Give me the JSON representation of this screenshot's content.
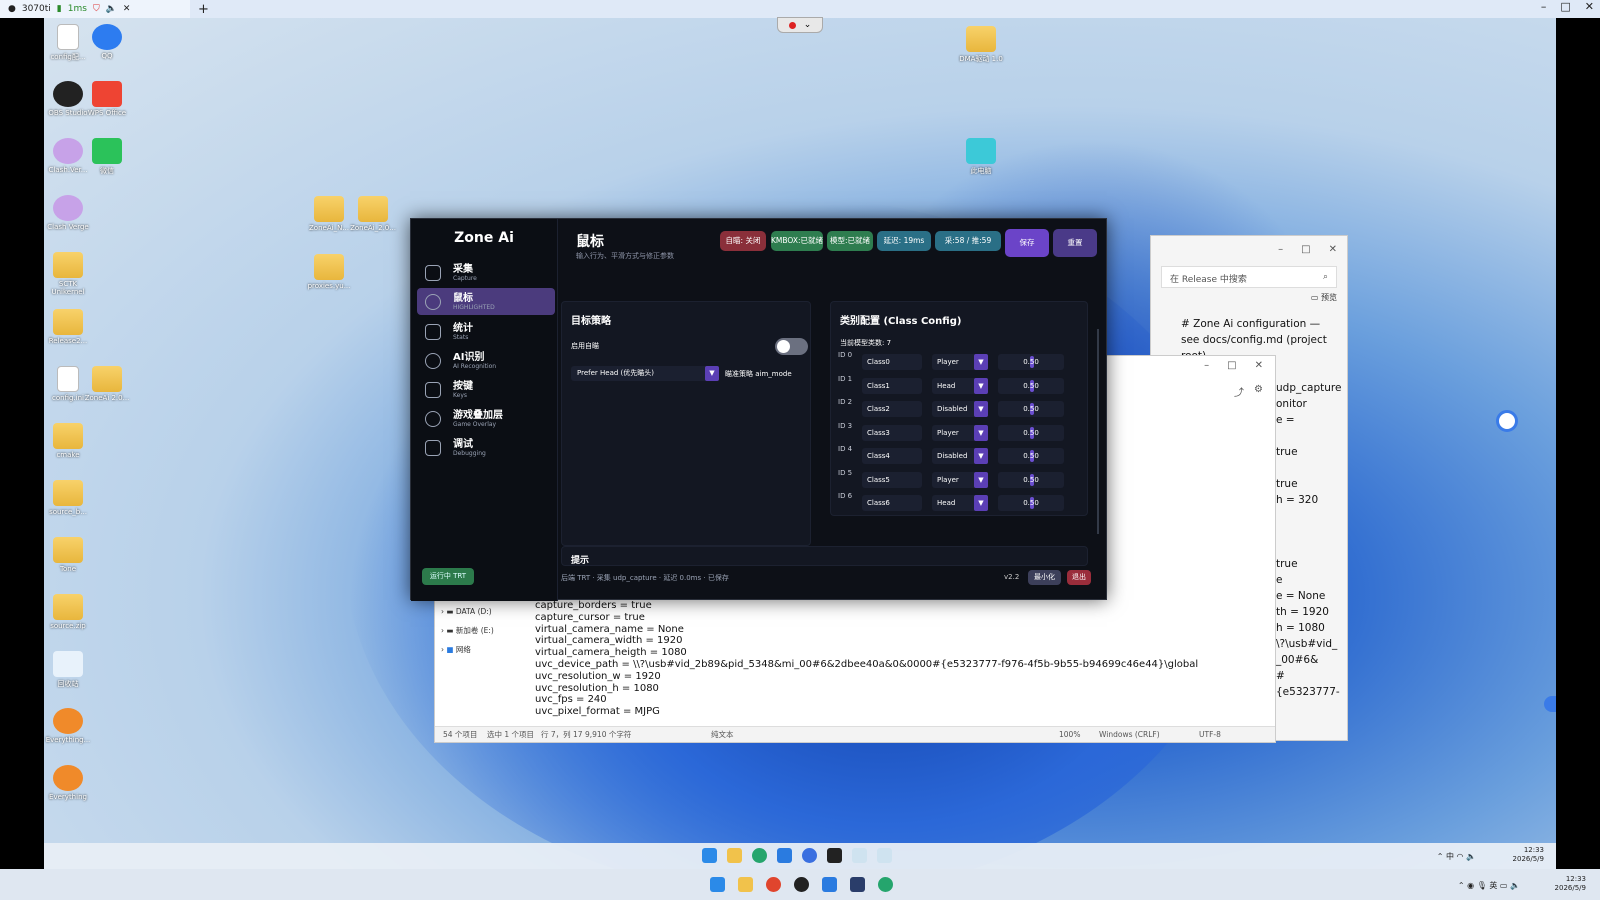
{
  "viewer": {
    "tab_title": "3070ti",
    "latency": "1ms"
  },
  "desktop_icons": [
    {
      "label": "config配...",
      "type": "doc"
    },
    {
      "label": "QQ",
      "type": "app"
    },
    {
      "label": "OBS Studio",
      "type": "app"
    },
    {
      "label": "WPS Office",
      "type": "app"
    },
    {
      "label": "Clash.Ver...",
      "type": "app"
    },
    {
      "label": "微信",
      "type": "app"
    },
    {
      "label": "Clash Verge",
      "type": "app"
    },
    {
      "label": "SCTK Unikernel",
      "type": "folder"
    },
    {
      "label": "Release2...",
      "type": "folder"
    },
    {
      "label": "config.ini",
      "type": "doc"
    },
    {
      "label": "ZoneAi 2.0...",
      "type": "folder"
    },
    {
      "label": "cmake",
      "type": "folder"
    },
    {
      "label": "source_b...",
      "type": "folder"
    },
    {
      "label": "Tone",
      "type": "folder"
    },
    {
      "label": "source.zip",
      "type": "folder"
    },
    {
      "label": "回收站",
      "type": "app"
    },
    {
      "label": "Everything...",
      "type": "app"
    },
    {
      "label": "Everything",
      "type": "app"
    },
    {
      "label": "ZoneAi_N...",
      "type": "folder"
    },
    {
      "label": "ZoneAi_2.0...",
      "type": "folder"
    },
    {
      "label": "proxies.yu...",
      "type": "folder"
    },
    {
      "label": "DMA驱动 1.0",
      "type": "folder"
    },
    {
      "label": "此电脑",
      "type": "app"
    }
  ],
  "explorer": {
    "search_placeholder": "在 Release 中搜索",
    "preview_label": "预览",
    "snippet": "# Zone Ai configuration — see docs/config.md (project root)"
  },
  "peek_lines": [
    "udp_capture",
    "onitor",
    "e =",
    "true",
    "true",
    "h = 320",
    "true",
    "e",
    "e = None",
    "th = 1920",
    "h = 1080",
    "\\?\\usb#vid_",
    "_00#6&",
    "#{e5323777-"
  ],
  "notepad": {
    "tree": [
      "DATA (D:)",
      "新加卷 (E:)",
      "网络"
    ],
    "lines": [
      "capture_borders = true",
      "capture_cursor = true",
      "virtual_camera_name = None",
      "virtual_camera_width = 1920",
      "virtual_camera_heigth = 1080",
      "uvc_device_path = \\\\?\\usb#vid_2b89&pid_5348&mi_00#6&2dbee40a&0&0000#{e5323777-f976-4f5b-9b55-b94699c46e44}\\global",
      "uvc_resolution_w = 1920",
      "uvc_resolution_h = 1080",
      "uvc_fps = 240",
      "uvc_pixel_format = MJPG"
    ],
    "status": {
      "items": "54 个项目",
      "selected": "选中 1 个项目",
      "cursor": "行 7，列 17",
      "chars": "9,910 个字符",
      "mode": "纯文本",
      "zoom": "100%",
      "eol": "Windows (CRLF)",
      "encoding": "UTF-8"
    }
  },
  "zone": {
    "brand": "Zone Ai",
    "nav": [
      {
        "label": "采集",
        "sub": "Capture",
        "active": false
      },
      {
        "label": "鼠标",
        "sub": "HIGHLIGHTED",
        "active": true
      },
      {
        "label": "统计",
        "sub": "Stats",
        "active": false
      },
      {
        "label": "AI识别",
        "sub": "AI Recognition",
        "active": false
      },
      {
        "label": "按键",
        "sub": "Keys",
        "active": false
      },
      {
        "label": "游戏叠加层",
        "sub": "Game Overlay",
        "active": false
      },
      {
        "label": "调试",
        "sub": "Debugging",
        "active": false
      }
    ],
    "run_button": "运行中 TRT",
    "title": "鼠标",
    "subtitle": "输入行为、平滑方式与修正参数",
    "header_badges": [
      {
        "label": "自瞄: 关闭",
        "color": "#8a2f3a"
      },
      {
        "label": "KMBOX:已就绪",
        "color": "#2e7d4f"
      },
      {
        "label": "模型:已就绪",
        "color": "#2e7d4f"
      },
      {
        "label": "延迟: 19ms",
        "color": "#2a6f86"
      },
      {
        "label": "采:58 / 推:59",
        "color": "#2a6f86"
      }
    ],
    "save_label": "保存",
    "reset_label": "重置",
    "strategy": {
      "title": "目标策略",
      "enable_label": "启用自瞄",
      "enabled": false,
      "aim_value": "Prefer Head (优先瞄头)",
      "aim_caption": "瞄准策略 aim_mode"
    },
    "class_config": {
      "title": "类别配置 (Class Config)",
      "count_label": "当前模型类数: 7",
      "rows": [
        {
          "id": "ID 0",
          "name": "Class0",
          "role": "Player",
          "value": "0.50"
        },
        {
          "id": "ID 1",
          "name": "Class1",
          "role": "Head",
          "value": "0.50"
        },
        {
          "id": "ID 2",
          "name": "Class2",
          "role": "Disabled",
          "value": "0.50"
        },
        {
          "id": "ID 3",
          "name": "Class3",
          "role": "Player",
          "value": "0.50"
        },
        {
          "id": "ID 4",
          "name": "Class4",
          "role": "Disabled",
          "value": "0.50"
        },
        {
          "id": "ID 5",
          "name": "Class5",
          "role": "Player",
          "value": "0.50"
        },
        {
          "id": "ID 6",
          "name": "Class6",
          "role": "Head",
          "value": "0.50"
        }
      ]
    },
    "hint_title": "提示",
    "footer_status": "后端 TRT  ·  采集 udp_capture  ·  延迟 0.0ms  ·  已保存",
    "version": "v2.2",
    "minimize_label": "最小化",
    "exit_label": "退出"
  },
  "remote_clock": {
    "time": "12:33",
    "date": "2026/5/9"
  },
  "local_clock": {
    "time": "12:33",
    "date": "2026/5/9"
  },
  "tray": {
    "ime": "中",
    "lang": "英"
  },
  "colors": {
    "accent": "#5b3fb5",
    "active_nav": "#4b3b7d",
    "app_bg": "#0d1017"
  }
}
